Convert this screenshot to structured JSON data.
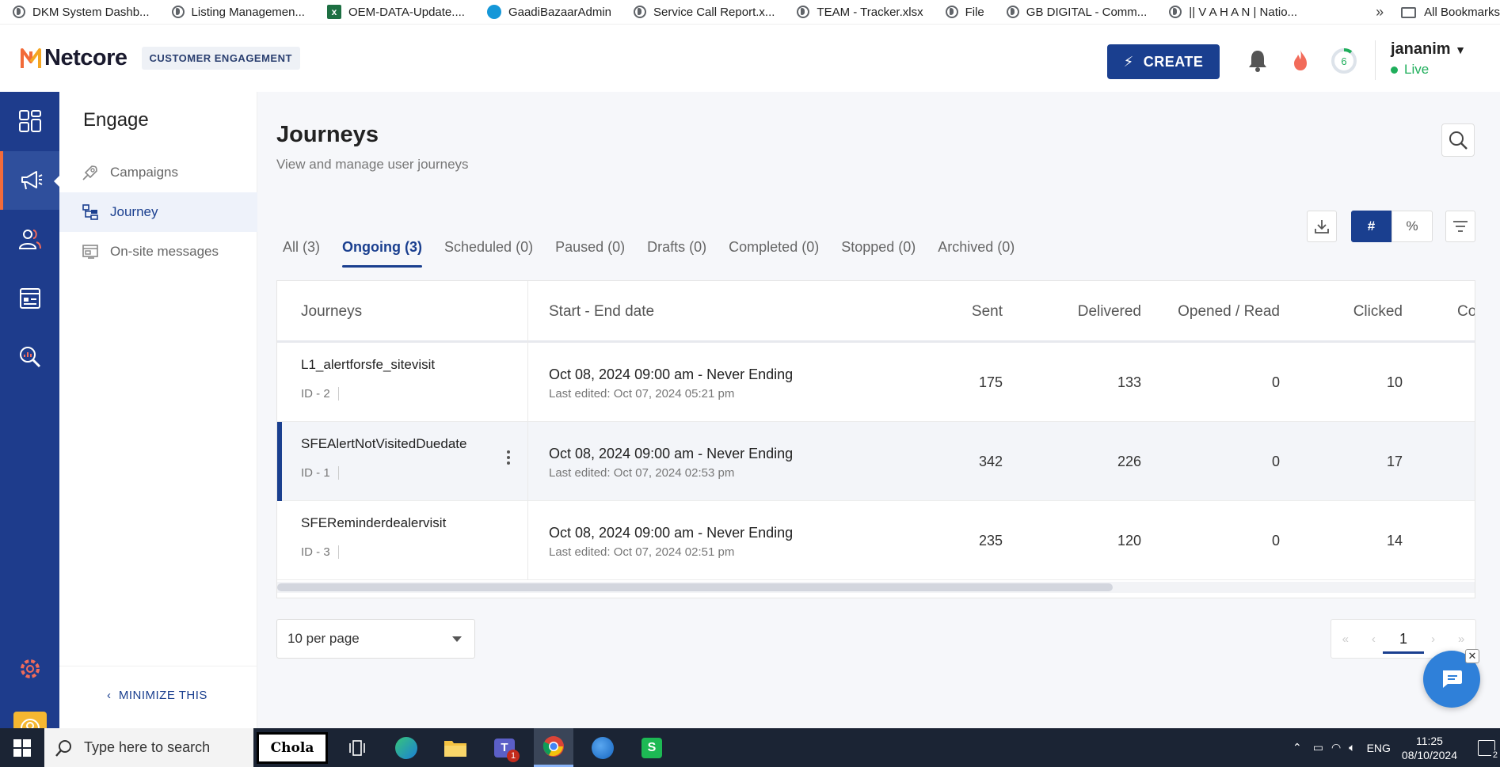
{
  "bookmarks": {
    "items": [
      {
        "label": "DKM System Dashb...",
        "icon": "globe"
      },
      {
        "label": "Listing Managemen...",
        "icon": "globe"
      },
      {
        "label": "OEM-DATA-Update....",
        "icon": "excel"
      },
      {
        "label": "GaadiBazaarAdmin",
        "icon": "cloud"
      },
      {
        "label": "Service Call Report.x...",
        "icon": "globe"
      },
      {
        "label": "TEAM - Tracker.xlsx",
        "icon": "globe"
      },
      {
        "label": "File",
        "icon": "globe"
      },
      {
        "label": "GB DIGITAL - Comm...",
        "icon": "globe"
      },
      {
        "label": "|| V A H A N | Natio...",
        "icon": "globe"
      }
    ],
    "more": "»",
    "all_bookmarks": "All Bookmarks"
  },
  "header": {
    "brand": "Netcore",
    "product_tag": "CUSTOMER ENGAGEMENT",
    "create_label": "CREATE",
    "progress_badge": "6",
    "user_name": "jananim",
    "user_status": "Live",
    "accent": "#1a3f8f",
    "status_color": "#1fae5b"
  },
  "rail": {
    "items": [
      "dashboard-icon",
      "megaphone-icon",
      "users-icon",
      "browser-icon",
      "analytics-icon"
    ],
    "bottom": [
      "settings-icon",
      "profile-icon"
    ]
  },
  "sidebar": {
    "title": "Engage",
    "items": [
      {
        "label": "Campaigns",
        "icon": "rocket-icon"
      },
      {
        "label": "Journey",
        "icon": "journey-icon"
      },
      {
        "label": "On-site messages",
        "icon": "onsite-icon"
      }
    ],
    "minimize": "MINIMIZE THIS"
  },
  "main": {
    "title": "Journeys",
    "subtitle": "View and manage user journeys",
    "tabs": [
      {
        "label": "All (3)"
      },
      {
        "label": "Ongoing (3)"
      },
      {
        "label": "Scheduled (0)"
      },
      {
        "label": "Paused (0)"
      },
      {
        "label": "Drafts (0)"
      },
      {
        "label": "Completed (0)"
      },
      {
        "label": "Stopped (0)"
      },
      {
        "label": "Archived (0)"
      }
    ],
    "toggle_count": "#",
    "toggle_percent": "%"
  },
  "table": {
    "columns": [
      "Journeys",
      "Start - End date",
      "Sent",
      "Delivered",
      "Opened / Read",
      "Clicked",
      "Co"
    ],
    "rows": [
      {
        "name": "L1_alertforsfe_sitevisit",
        "id": "ID - 2",
        "date": "Oct 08, 2024 09:00 am - Never Ending",
        "edited": "Last edited: Oct 07, 2024 05:21 pm",
        "sent": "175",
        "delivered": "133",
        "opened": "0",
        "clicked": "10"
      },
      {
        "name": "SFEAlertNotVisitedDuedate",
        "id": "ID - 1",
        "date": "Oct 08, 2024 09:00 am - Never Ending",
        "edited": "Last edited: Oct 07, 2024 02:53 pm",
        "sent": "342",
        "delivered": "226",
        "opened": "0",
        "clicked": "17"
      },
      {
        "name": "SFEReminderdealervisit",
        "id": "ID - 3",
        "date": "Oct 08, 2024 09:00 am - Never Ending",
        "edited": "Last edited: Oct 07, 2024 02:51 pm",
        "sent": "235",
        "delivered": "120",
        "opened": "0",
        "clicked": "14"
      }
    ]
  },
  "pagination": {
    "per_page": "10 per page",
    "first": "«",
    "prev": "‹",
    "current": "1",
    "next": "›",
    "last": "»"
  },
  "taskbar": {
    "search_placeholder": "Type here to search",
    "chola_label": "Chola",
    "teams_badge": "1",
    "language": "ENG",
    "time": "11:25",
    "date": "08/10/2024",
    "notification_count": "2"
  }
}
